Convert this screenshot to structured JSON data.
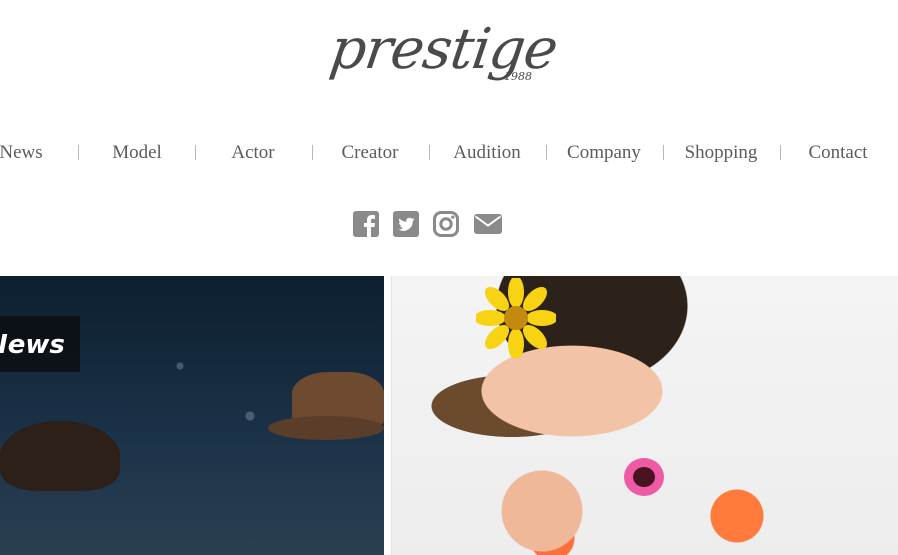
{
  "logo": {
    "word": "prestige",
    "year": "1988"
  },
  "nav": {
    "items": [
      {
        "label": "News"
      },
      {
        "label": "Model"
      },
      {
        "label": "Actor"
      },
      {
        "label": "Creator"
      },
      {
        "label": "Audition"
      },
      {
        "label": "Company"
      },
      {
        "label": "Shopping"
      },
      {
        "label": "Contact"
      }
    ]
  },
  "social": {
    "icons": [
      "facebook-icon",
      "twitter-icon",
      "instagram-icon",
      "mail-icon"
    ],
    "color": "#8a8a8a"
  },
  "panels": {
    "left": {
      "label": "News"
    }
  }
}
